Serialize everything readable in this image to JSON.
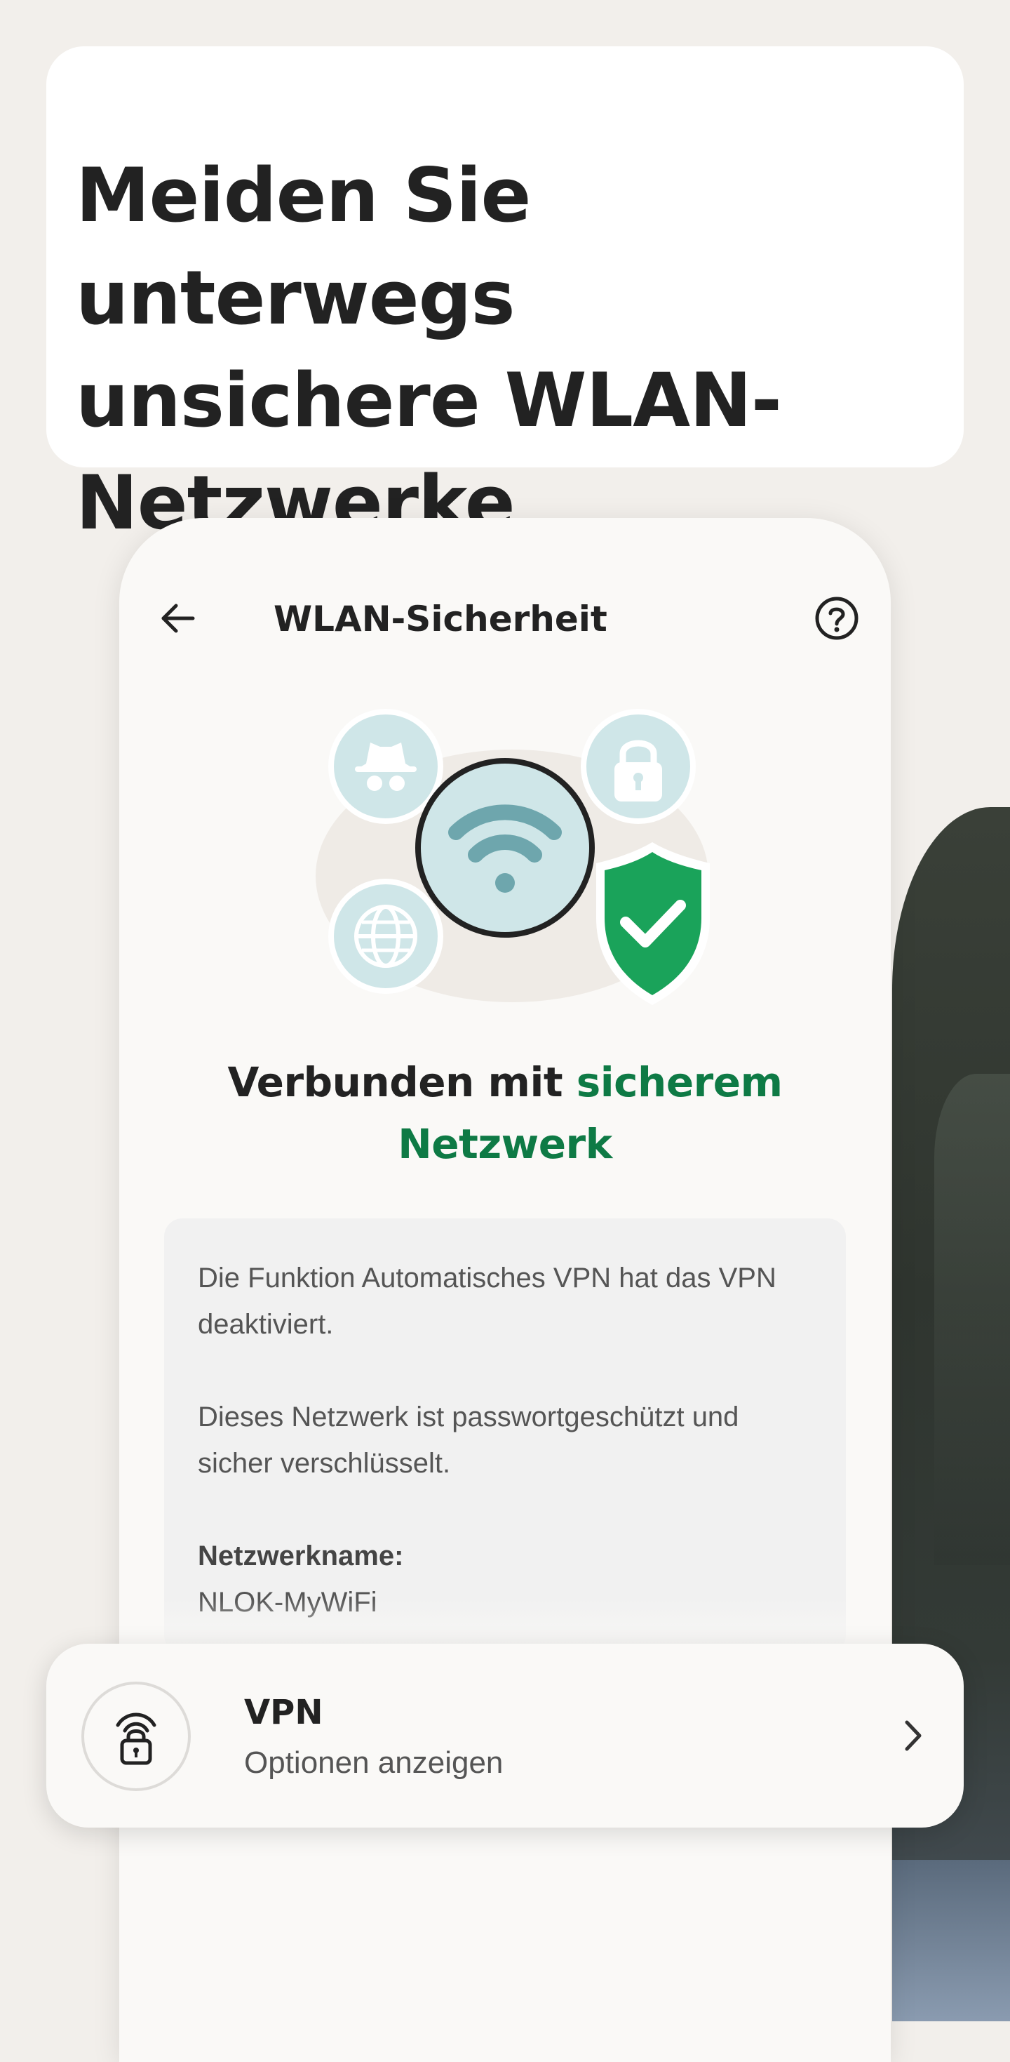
{
  "headline": "Meiden Sie unterwegs unsichere WLAN-Netzwerke",
  "app": {
    "title": "WLAN-Sicherheit",
    "back_icon": "arrow-left-icon",
    "help_icon": "question-circle-icon"
  },
  "status": {
    "prefix": "Verbunden mit ",
    "accent": "sicherem Netzwerk",
    "accent_color": "#0e7a45"
  },
  "info": {
    "paragraph1": "Die Funktion Automatisches VPN hat das VPN deaktiviert.",
    "paragraph2": "Dieses Netzwerk ist passwortgeschützt und sicher verschlüsselt.",
    "network_label": "Netzwerkname:",
    "network_value": "NLOK-MyWiFi"
  },
  "vpn": {
    "title": "VPN",
    "subtitle": "Optionen anzeigen",
    "icon": "vpn-lock-icon",
    "chevron_icon": "chevron-right-icon"
  },
  "colors": {
    "background": "#f2efeb",
    "shield_green": "#1aa35a",
    "icon_bubble": "#cfe6e8",
    "wifi_teal": "#6ea6ad"
  }
}
